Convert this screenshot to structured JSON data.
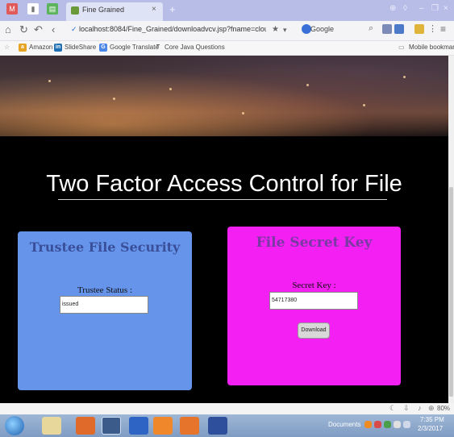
{
  "browser": {
    "tab_title": "Fine Grained",
    "tab_close": "×",
    "new_tab": "+",
    "url": "localhost:8084/Fine_Grained/downloadvcv.jsp?fname=cloud%20co",
    "search_engine": "Google",
    "bookmarks": [
      {
        "label": "Amazon",
        "icon_color": "#e5a321",
        "icon": "a"
      },
      {
        "label": "SlideShare",
        "icon_color": "#1f6fb5",
        "icon": "in"
      },
      {
        "label": "Google Translate",
        "icon_color": "#4a85e8",
        "icon": "G"
      },
      {
        "label": "Core Java Questions",
        "icon_color": "#666666",
        "icon": "T"
      }
    ],
    "mobile_bookmarks": "Mobile bookmarks",
    "zoom": "80%"
  },
  "page": {
    "title": "Two Factor Access Control for File",
    "trustee": {
      "heading": "Trustee File Security",
      "status_label": "Trustee Status :",
      "status_value": "issued"
    },
    "secret": {
      "heading": "File Secret Key",
      "key_label": "Secret Key :",
      "key_value": "54717380",
      "download_label": "Download"
    }
  },
  "taskbar": {
    "documents": "Documents",
    "time": "7:35 PM",
    "date": "2/3/2017"
  },
  "colors": {
    "trustee_panel": "#6594ea",
    "secret_panel": "#f31ff3",
    "page_background": "#000000"
  }
}
